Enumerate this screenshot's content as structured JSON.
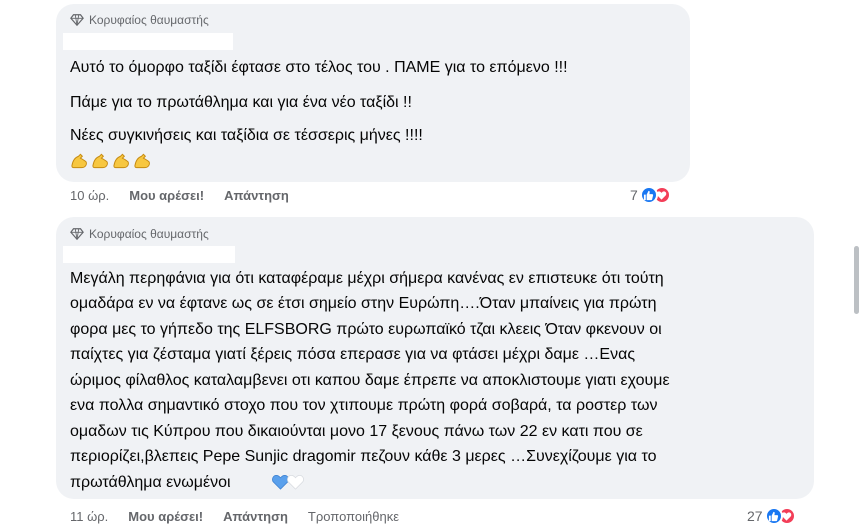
{
  "comment1": {
    "badge": "Κορυφαίος θαυμαστής",
    "lines": [
      "Αυτό το όμορφο ταξίδι έφτασε στο τέλος του . ΠΑΜΕ για το επόμενο !!!",
      "Πάμε για το πρωτάθλημα και για ένα νέο ταξίδι !!",
      "Νέες συγκινήσεις και ταξίδια σε τέσσερις μήνες !!!!"
    ],
    "emoji": "muscle-emoji",
    "time": "10 ώρ.",
    "like": "Μου αρέσει!",
    "reply": "Απάντηση",
    "reaction_count": "7"
  },
  "comment2": {
    "badge": "Κορυφαίος θαυμαστής",
    "lines": [
      "Μεγάλη περηφάνια για ότι καταφέραμε μέχρι σήμερα κανένας εν επιστευκε ότι τούτη",
      "ομαδάρα εν να έφτανε ως σε έτσι σημείο στην Ευρώπη….Όταν μπαίνεις για πρώτη",
      "φορα μες το γήπεδο της ELFSBORG πρώτο ευρωπαϊκό τζαι κλεεις Όταν φκενουν οι",
      "παίχτες για ζέσταμα γιατί ξέρεις πόσα επερασε για να φτάσει μέχρι δαμε …Ενας",
      "ώριμος φίλαθλος καταλαμβενει οτι καπου δαμε έπρεπε να αποκλιστουμε γιατι εχουμε",
      "ενα πολλα σημαντικό στοχο που τον χτιπουμε πρώτη φορά σοβαρά, τα ροστερ των",
      "ομαδων τις Κύπρου που δικαιούνται μονο 17 ξενους πάνω των 22 εν κατι που σε",
      "περιορίζει,βλεπεις Pepe Sunjic dragomir πεζουν κάθε 3 μερες …Συνεχίζουμε για το",
      "πρωτάθλημα ενωμένοι"
    ],
    "emoji": "blue-white-hearts-emoji",
    "time": "11 ώρ.",
    "like": "Μου αρέσει!",
    "reply": "Απάντηση",
    "edited": "Τροποποιήθηκε",
    "reaction_count": "27"
  },
  "colors": {
    "bubble": "#f0f2f5",
    "like_blue": "#1877f2",
    "love_red": "#f33e58",
    "meta_gray": "#65676b"
  }
}
